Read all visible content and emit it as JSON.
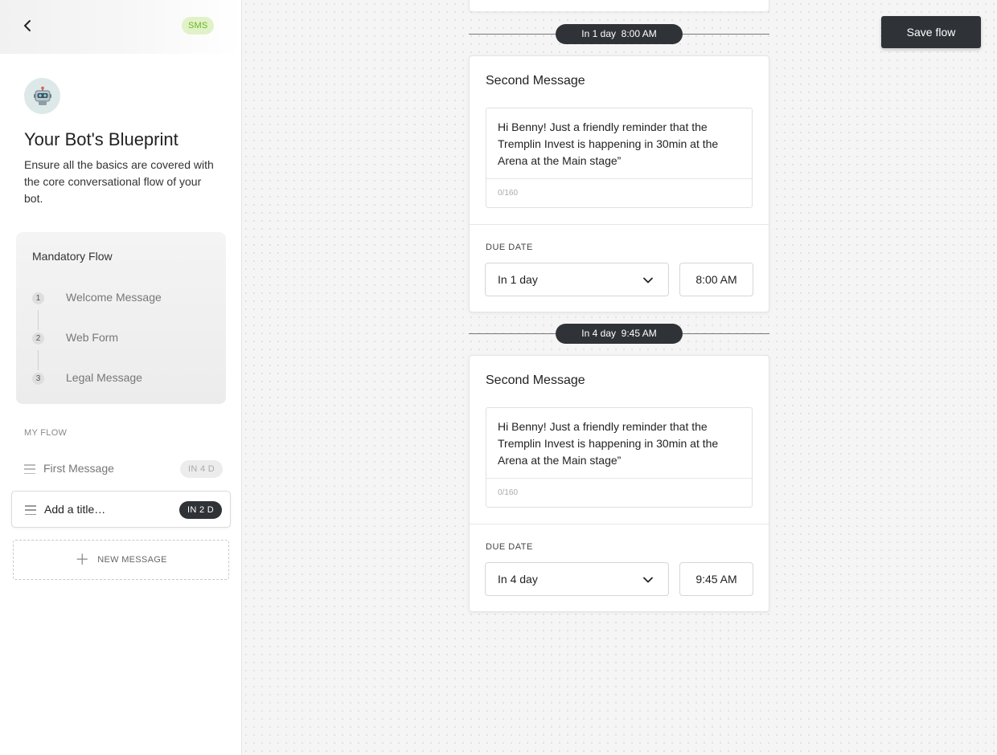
{
  "sidebar": {
    "channel_badge": "SMS",
    "title": "Your Bot's Blueprint",
    "description": "Ensure all the basics are covered with the core conversational flow of your bot.",
    "mandatory": {
      "title": "Mandatory Flow",
      "steps": [
        {
          "num": "1",
          "label": "Welcome Message"
        },
        {
          "num": "2",
          "label": "Web Form"
        },
        {
          "num": "3",
          "label": "Legal Message"
        }
      ]
    },
    "my_flow_label": "MY FLOW",
    "flow_items": [
      {
        "title": "First Message",
        "badge": "IN 4 D"
      },
      {
        "title": "Add a title…",
        "badge": "IN 2 D"
      }
    ],
    "new_message_label": "NEW MESSAGE"
  },
  "canvas": {
    "save_label": "Save flow",
    "dividers": [
      {
        "label": "In 1 day  8:00 AM"
      },
      {
        "label": "In 4 day  9:45 AM"
      }
    ],
    "cards": [
      {
        "title": "Second Message",
        "message": "Hi Benny! Just a friendly reminder that the Tremplin Invest is happening in 30min at the Arena at the Main stage”",
        "char_count": "0/160",
        "due_label": "DUE DATE",
        "due_value": "In 1 day",
        "time_value": "8:00 AM"
      },
      {
        "title": "Second Message",
        "message": "Hi Benny! Just a friendly reminder that the Tremplin Invest is happening in 30min at the Arena at the Main stage”",
        "char_count": "0/160",
        "due_label": "DUE DATE",
        "due_value": "In 4 day",
        "time_value": "9:45 AM"
      }
    ]
  },
  "icons": {
    "back": "chevron-left-icon",
    "avatar": "robot-icon",
    "drag": "drag-handle-icon",
    "add": "plus-icon",
    "dropdown": "chevron-down-icon"
  },
  "colors": {
    "dark": "#2f3337",
    "sms_badge_bg": "#e2f2c8",
    "sms_badge_text": "#69b521"
  }
}
